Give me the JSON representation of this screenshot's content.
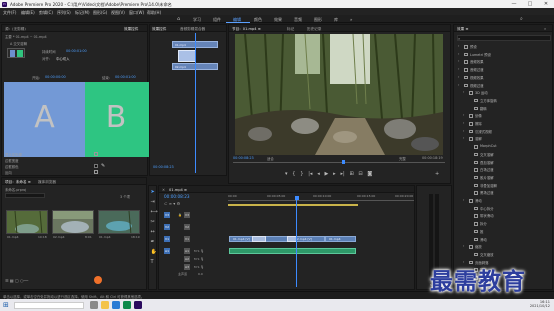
{
  "window": {
    "title": "Adobe Premiere Pro 2020 - C:\\用户\\Video\\文档\\Adobe\\Premiere Pro\\14.0\\未命名",
    "app_icon": "Pr",
    "controls": [
      "—",
      "□",
      "✕"
    ]
  },
  "menu": [
    "文件(F)",
    "编辑(E)",
    "剪辑(C)",
    "序列(S)",
    "标记(M)",
    "图形(G)",
    "视图(V)",
    "窗口(W)",
    "帮助(H)"
  ],
  "workspaces": {
    "home_icon": "home-icon",
    "items": [
      "学习",
      "组件",
      "编辑",
      "颜色",
      "效果",
      "音频",
      "图形",
      "库",
      "»"
    ],
    "active_index": 2
  },
  "effect_controls": {
    "header": "源：(无剪辑)",
    "tab_label": "效果控件",
    "tab_other": "Lumetri 范围",
    "source_row": "主要 * 01.mp4 ~ 01.mp4",
    "clip_label": "01.mp4",
    "section_transition": "A 交叉溶解",
    "duration_label": "持续时间",
    "duration_value": "00:00:01:00",
    "alignment_label": "对齐：",
    "alignment_value": "中心切入",
    "start_label": "开始：",
    "start_value": "00:00:00:00",
    "end_label": "结束：",
    "end_value": "00:00:01:00",
    "a_label": "A",
    "b_label": "B",
    "show_actual_sources": "显示实际源",
    "reverse": "反向",
    "border_width": "边框宽度",
    "border_color": "边框颜色",
    "anti_alias": "消除锯齿品质",
    "timecode": "00:00:08:23"
  },
  "mini_timeline": {
    "tabs": [
      "效果控件",
      "音频剪辑混合器"
    ],
    "clip_a": "01.mp4",
    "clip_b": "02.mp4"
  },
  "program": {
    "tab": "节目：01.mp4 ≡",
    "other_tabs": [
      "标记",
      "历史记录"
    ],
    "timecode": "00:00:08:23",
    "fit": "适合",
    "quality": "完整",
    "duration": "00:00:18:19"
  },
  "project": {
    "tabs": [
      "项目：未命名 ≡",
      "媒体浏览器"
    ],
    "path": "未命名.prproj",
    "items_count": "3 个项",
    "clips": [
      {
        "name": "01.mp4",
        "dur": "10:18"
      },
      {
        "name": "02.mp4",
        "dur": "8:01"
      },
      {
        "name": "01.mp4",
        "dur": "18:19"
      }
    ]
  },
  "timeline": {
    "tab": "01.mp4 ≡",
    "timecode": "00:00:08:23",
    "ruler": [
      "00:00",
      "00:00:05:00",
      "00:00:10:00",
      "00:00:15:00",
      "00:00:20:00"
    ],
    "video_tracks": [
      "V3",
      "V2",
      "V1"
    ],
    "audio_tracks": [
      "A1",
      "A2",
      "A3"
    ],
    "master": "主声道",
    "master_value": "0.0",
    "clips_v1": [
      "01.mp4 [V]",
      "02.mp4 [V]",
      "01.mp4"
    ]
  },
  "effects": {
    "tab": "效果 ≡",
    "search_placeholder": "",
    "rows": [
      {
        "text": "预设",
        "level": 0
      },
      {
        "text": "Lumetri 预设",
        "level": 0
      },
      {
        "text": "音频效果",
        "level": 0
      },
      {
        "text": "音频过渡",
        "level": 0
      },
      {
        "text": "视频效果",
        "level": 0
      },
      {
        "text": "视频过渡",
        "level": 0
      },
      {
        "text": "3D 运动",
        "level": 1
      },
      {
        "text": "立方体旋转",
        "level": 2
      },
      {
        "text": "翻转",
        "level": 2
      },
      {
        "text": "划像",
        "level": 1
      },
      {
        "text": "擦除",
        "level": 1
      },
      {
        "text": "沉浸式视频",
        "level": 1
      },
      {
        "text": "溶解",
        "level": 1
      },
      {
        "text": "MorphCut",
        "level": 2
      },
      {
        "text": "交叉溶解",
        "level": 2
      },
      {
        "text": "叠加溶解",
        "level": 2
      },
      {
        "text": "白场过渡",
        "level": 2
      },
      {
        "text": "胶片溶解",
        "level": 2
      },
      {
        "text": "非叠加溶解",
        "level": 2
      },
      {
        "text": "黑场过渡",
        "level": 2
      },
      {
        "text": "滑动",
        "level": 1
      },
      {
        "text": "中心拆分",
        "level": 2
      },
      {
        "text": "带状滑动",
        "level": 2
      },
      {
        "text": "拆分",
        "level": 2
      },
      {
        "text": "推",
        "level": 2
      },
      {
        "text": "滑动",
        "level": 2
      },
      {
        "text": "缩放",
        "level": 1
      },
      {
        "text": "交叉缩放",
        "level": 2
      },
      {
        "text": "页面剥落",
        "level": 1
      },
      {
        "text": "翻页",
        "level": 2
      },
      {
        "text": "页面剥落",
        "level": 2
      }
    ]
  },
  "status_bar": "单击以选择，或单击空白处并拖动以进行选区选择。使用 Shift、Alt 和 Ctrl 可获得其他选项。",
  "taskbar": {
    "time": "16:11",
    "date": "2021/10/12"
  },
  "watermark": "最需教育"
}
